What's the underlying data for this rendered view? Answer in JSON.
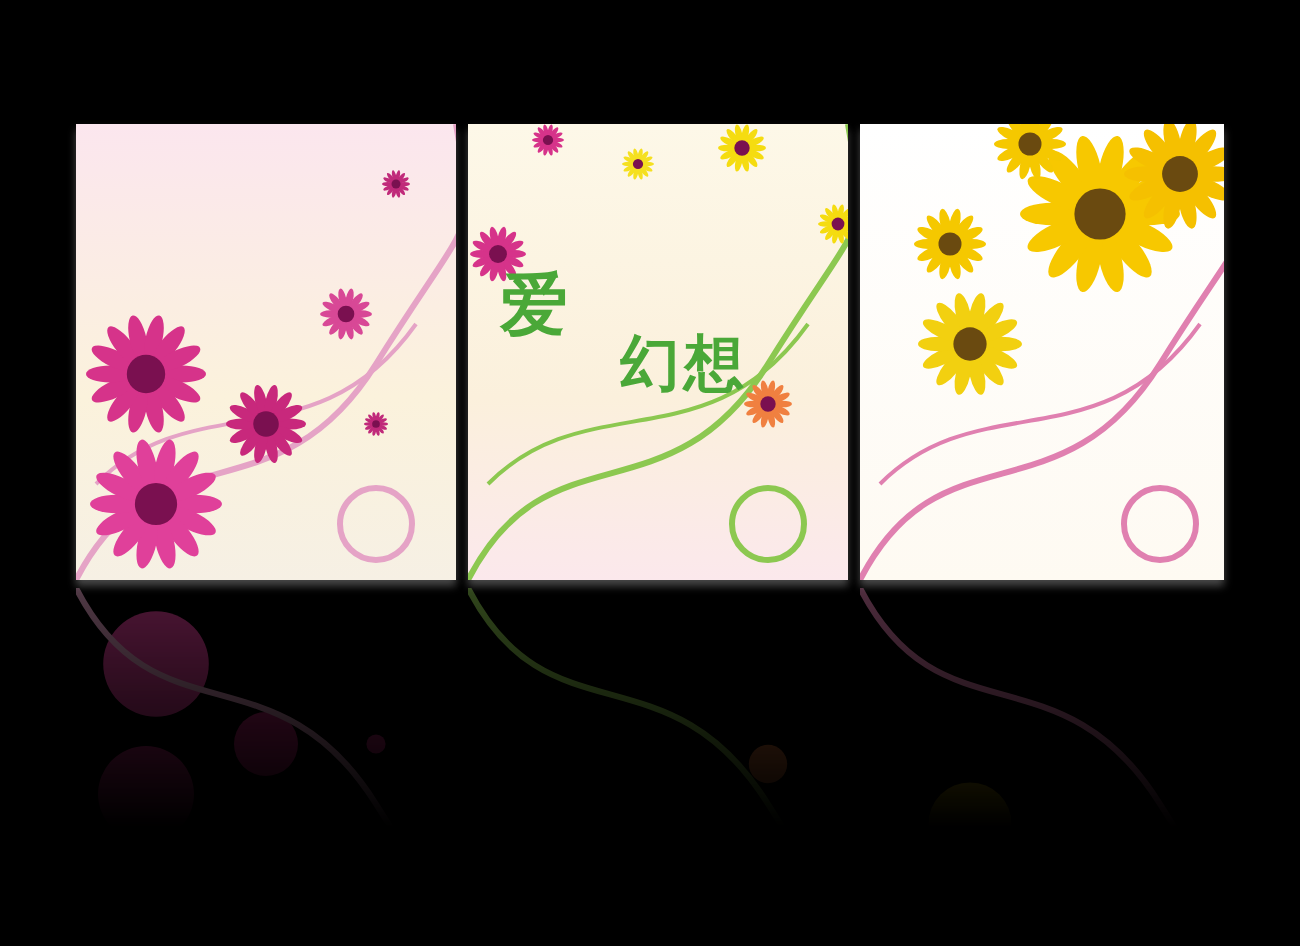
{
  "panels": [
    {
      "kind": "pink-flowers"
    },
    {
      "kind": "title",
      "title_parts": [
        "爱",
        "幻想"
      ]
    },
    {
      "kind": "sunflowers"
    }
  ]
}
